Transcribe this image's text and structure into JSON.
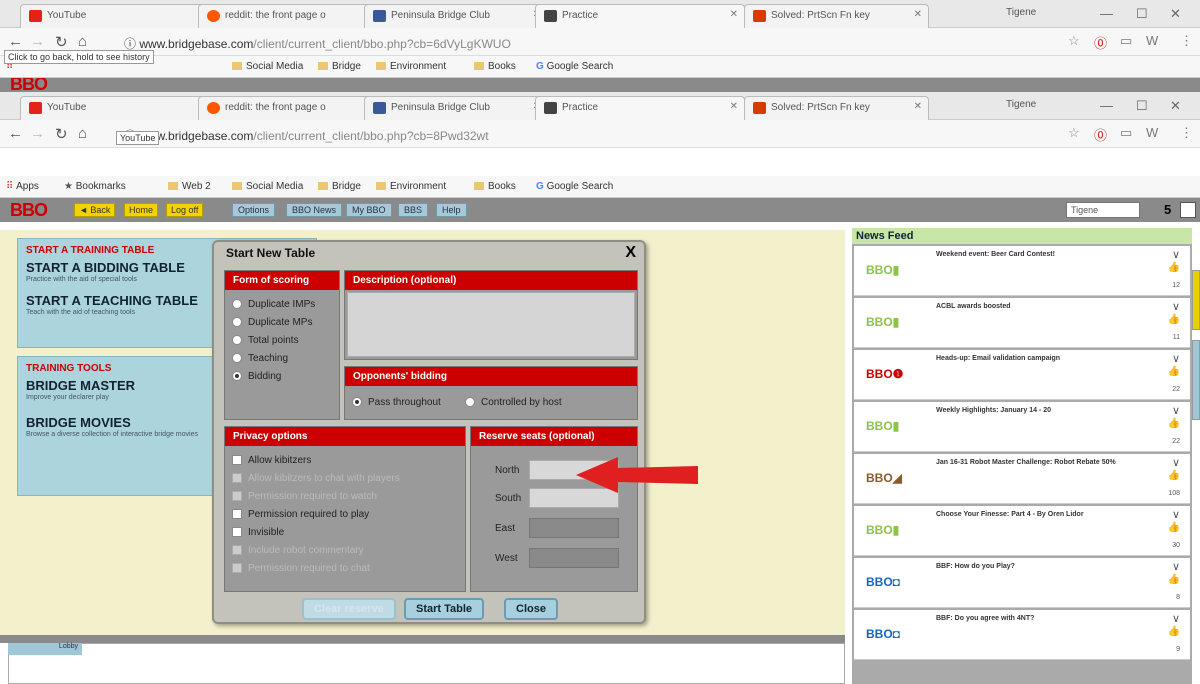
{
  "tabs": [
    {
      "label": "YouTube",
      "color": "#e62117"
    },
    {
      "label": "reddit: the front page o",
      "color": "#ff5700"
    },
    {
      "label": "Peninsula Bridge Club",
      "color": "#3b5998"
    },
    {
      "label": "Practice",
      "color": "#444444"
    },
    {
      "label": "Solved: PrtScn Fn key",
      "color": "#d83b01"
    }
  ],
  "profile_name": "Tigene",
  "urls": {
    "back": {
      "domain": "www.bridgebase.com",
      "path": "/client/current_client/bbo.php?cb=6dVyLgKWUO"
    },
    "front": {
      "domain": "www.bridgebase.com",
      "path": "/client/current_client/bbo.php?cb=8Pwd32wt"
    }
  },
  "tooltips": {
    "back": "Click to go back, hold to see history",
    "youtube": "YouTube"
  },
  "bookmarks": {
    "apps": "Apps",
    "bookmarks": "Bookmarks",
    "web2": "Web 2",
    "social": "Social Media",
    "bridge": "Bridge",
    "environment": "Environment",
    "books": "Books",
    "google": "Google Search"
  },
  "bbo": {
    "logo": "BBO",
    "back": "◄ Back",
    "home": "Home",
    "logoff": "Log off",
    "options": "Options",
    "bbo_news": "BBO News",
    "my_bbo": "My BBO",
    "bbs": "BBS",
    "help": "Help",
    "username": "Tigene",
    "counter": "5"
  },
  "left_panel": {
    "training_table_header": "START A TRAINING TABLE",
    "bidding_table": "START A BIDDING TABLE",
    "bidding_table_sub": "Practice with the aid of special tools",
    "teaching_table": "START A TEACHING TABLE",
    "teaching_table_sub": "Teach with the aid of teaching tools",
    "training_tools_header": "TRAINING TOOLS",
    "bridge_master": "BRIDGE MASTER",
    "bridge_master_sub": "Improve your declarer play",
    "bridge_movies": "BRIDGE MOVIES",
    "bridge_movies_sub": "Browse a diverse collection of interactive bridge movies"
  },
  "dialog": {
    "title": "Start New Table",
    "close": "X",
    "scoring_header": "Form of scoring",
    "scoring_options": [
      "Duplicate IMPs",
      "Duplicate MPs",
      "Total points",
      "Teaching",
      "Bidding"
    ],
    "description_header": "Description (optional)",
    "opponents_header": "Opponents' bidding",
    "opponents_options": [
      "Pass throughout",
      "Controlled by host"
    ],
    "privacy_header": "Privacy options",
    "privacy_options": [
      {
        "label": "Allow kibitzers",
        "enabled": true
      },
      {
        "label": "Allow kibitzers to chat with players",
        "enabled": false
      },
      {
        "label": "Permission required to watch",
        "enabled": false
      },
      {
        "label": "Permission required to play",
        "enabled": true
      },
      {
        "label": "Invisible",
        "enabled": true
      },
      {
        "label": "Include robot commentary",
        "enabled": false
      },
      {
        "label": "Permission required to chat",
        "enabled": false
      }
    ],
    "seats_header": "Reserve seats (optional)",
    "seats": [
      "North",
      "South",
      "East",
      "West"
    ],
    "buttons": {
      "clear": "Clear reserve",
      "start": "Start Table",
      "close": "Close"
    }
  },
  "news_feed": {
    "title": "News Feed",
    "items": [
      {
        "logo": "BBO",
        "text": "Weekend event: Beer Card Contest!",
        "count": "12"
      },
      {
        "logo": "BBO",
        "text": "ACBL awards boosted",
        "count": "11"
      },
      {
        "logo": "BBO",
        "text": "Heads-up: Email validation campaign",
        "count": "22"
      },
      {
        "logo": "BBO",
        "text": "Weekly Highlights: January 14 - 20",
        "count": "22"
      },
      {
        "logo": "BBO",
        "text": "Jan 16-31 Robot Master Challenge: Robot Rebate 50%",
        "count": "108"
      },
      {
        "logo": "BBO",
        "text": "Choose Your Finesse: Part 4 - By Oren Lidor",
        "count": "30"
      },
      {
        "logo": "BBO",
        "text": "BBF: How do you Play?",
        "count": "8"
      },
      {
        "logo": "BBO",
        "text": "BBF: Do you agree with 4NT?",
        "count": "9"
      }
    ]
  },
  "lobby_tab": "Lobby",
  "colors": {
    "bbo_red": "#cc0000",
    "accent_yellow": "#f2d200",
    "panel_blue": "#acd4dc",
    "panel_cream": "#f3f0cc"
  }
}
